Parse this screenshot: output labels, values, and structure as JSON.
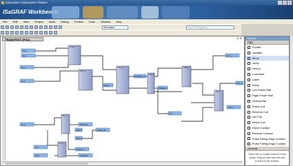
{
  "window": {
    "title": "Automation Collaborative Platform",
    "min": "_",
    "max": "□",
    "close": "x"
  },
  "banner": {
    "product": "ISaGRAF Workbench"
  },
  "menu": [
    "File",
    "Edit",
    "View",
    "Project",
    "Build",
    "Debug",
    "Format",
    "Tools",
    "Window",
    "Help"
  ],
  "toolbar": {
    "mode": "Simulation",
    "search_placeholder": "Code Timing (sec)"
  },
  "editor": {
    "tab_title": "TRANSFEST (POU)",
    "close_label": "✕ ✕",
    "diagram": {
      "inputs": [
        "IN_1",
        "IN_2",
        "IN_3",
        "IN_4",
        "TRIG_A",
        "PRESET_1",
        "IN_5",
        "IN_6",
        "IN_7",
        "IN_8",
        "TRIG_B",
        "TRIG_C"
      ],
      "outputs": [
        "STEPPER_1",
        "OUT_1",
        "OUT_2",
        "OUT_3",
        "PULSE_A",
        "PULSE_B",
        "PULSE_C",
        "PULSE_D"
      ],
      "blocks": [
        "TON_1",
        "TON_2",
        "CTU_1",
        "CTU_2",
        "AND_1",
        "TP_1",
        "TP_2",
        "TP_3"
      ]
    }
  },
  "sidebar": {
    "title": "Toolbox",
    "section": "FBD",
    "items": [
      "Pointer",
      "Variable",
      "Block",
      "Jump",
      "Return",
      "Comment",
      "Label",
      "Rung",
      "Left Power Rail",
      "Right Power Rail",
      "Vertical Bar",
      "Direct Coil",
      "Reverse Coil",
      "Set Coil",
      "Reset Coil",
      "Direct Contact",
      "Reverse Contact",
      "Pulse Rising Edge Contact",
      "Pulse Falling Edge Contact"
    ],
    "general": "General",
    "note": "There are no usable controls in this group. Drag an item onto this text to add it to the toolbox."
  }
}
